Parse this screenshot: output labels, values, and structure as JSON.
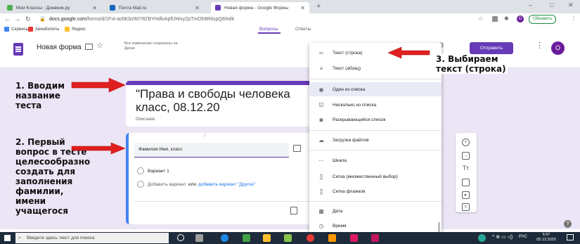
{
  "browser": {
    "tabs": [
      {
        "label": "Мои Классы - Дневник.ру",
        "color": "#4caf50"
      },
      {
        "label": "Почта Mail.ru",
        "color": "#1565c0"
      },
      {
        "label": "Новая форма - Google Формы",
        "color": "#673ab7"
      }
    ],
    "new_tab": "+",
    "window_controls": [
      "–",
      "□",
      "✕"
    ],
    "url_domain": "docs.google.com",
    "url_path": "/forms/d/1Fvt-ao5KbzWI78ZBYHdlvApfUHixyZpTmOh8RitspQ8/edit",
    "update_button": "Обновить",
    "bookmarks": [
      "Сервисы",
      "Авиабилеты",
      "Яндекс"
    ]
  },
  "forms": {
    "title": "Новая форма",
    "saved_status": "Все изменения сохранены на Диске",
    "send_button": "Отправить",
    "avatar_letter": "О",
    "tabs": [
      "Вопросы",
      "Ответы"
    ],
    "accent_color": "#673ab7"
  },
  "form_card": {
    "title": "\"Права и свободы человека",
    "subtitle": "класс, 08.12.20",
    "description_placeholder": "Описание"
  },
  "question_card": {
    "question_text": "Фамилия Имя, класс",
    "option1": "Вариант 1",
    "add_option": "Добавить вариант",
    "or_text": "или",
    "add_other": "добавить вариант \"Другое\""
  },
  "menu": {
    "items": [
      {
        "label": "Текст (строка)",
        "icon": "short-text-icon"
      },
      {
        "label": "Текст (абзац)",
        "icon": "paragraph-icon"
      },
      {
        "label": "Один из списка",
        "icon": "radio-icon"
      },
      {
        "label": "Несколько из списка",
        "icon": "checkbox-icon"
      },
      {
        "label": "Раскрывающийся список",
        "icon": "dropdown-icon"
      },
      {
        "label": "Загрузка файлов",
        "icon": "cloud-upload-icon"
      },
      {
        "label": "Шкала",
        "icon": "scale-icon"
      },
      {
        "label": "Сетка (множественный выбор)",
        "icon": "grid-icon"
      },
      {
        "label": "Сетка флажков",
        "icon": "checkbox-grid-icon"
      },
      {
        "label": "Дата",
        "icon": "date-icon"
      },
      {
        "label": "Время",
        "icon": "time-icon"
      }
    ]
  },
  "annotations": {
    "step1": "1. Вводим\nназвание\nтеста",
    "step2": "2. Первый\nвопрос в тесте\nцелесообразно\nсоздать для\nзаполнения\nфамилии,\nимени\nучащегося",
    "step3": "3. Выбираем\nтекст (строка)"
  },
  "taskbar": {
    "search_placeholder": "Введите здесь текст для поиска",
    "lang": "РУС",
    "time": "5:57",
    "date": "05.12.2020"
  }
}
